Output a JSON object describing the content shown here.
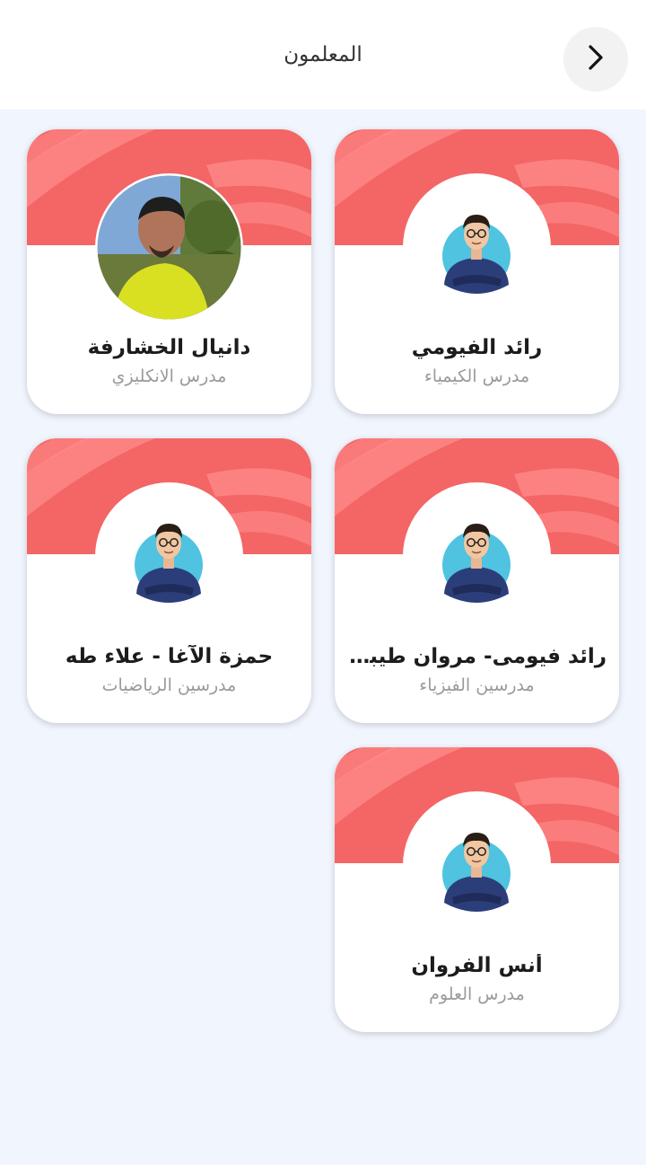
{
  "header": {
    "title": "المعلمون",
    "back_icon": "chevron-right-icon"
  },
  "colors": {
    "banner": "#f46565",
    "banner_stripe": "#ff8c8c",
    "page_background": "#f1f5fd",
    "avatar_accent": "#4fc3e0",
    "shirt": "#2c3e7a"
  },
  "teachers": [
    {
      "name": "رائد الفيومي",
      "subject": "مدرس الكيمياء",
      "avatar": "illustrated-teacher-avatar"
    },
    {
      "name": "دانيال الخشارفة",
      "subject": "مدرس الانكليزي",
      "avatar": "photo-avatar"
    },
    {
      "name": "رائد فيومى- مروان طيبانى ...",
      "subject": "مدرسين الفيزياء",
      "avatar": "illustrated-teacher-avatar"
    },
    {
      "name": "حمزة الآغا - علاء طه",
      "subject": "مدرسين الرياضيات",
      "avatar": "illustrated-teacher-avatar"
    },
    {
      "name": "أنس الفروان",
      "subject": "مدرس العلوم",
      "avatar": "illustrated-teacher-avatar"
    }
  ]
}
